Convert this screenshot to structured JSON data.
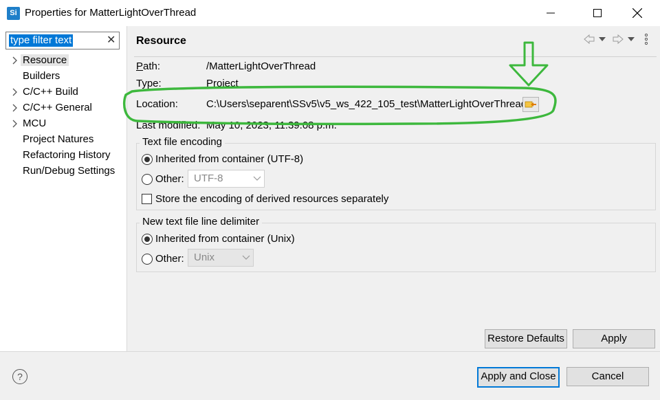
{
  "window": {
    "title": "Properties for MatterLightOverThread",
    "app_icon": "Si",
    "controls": [
      "minimize-icon",
      "maximize-icon",
      "close-icon"
    ]
  },
  "filter": {
    "placeholder": "type filter text",
    "value": "type filter text"
  },
  "tree": {
    "items": [
      {
        "label": "Resource",
        "expandable": true,
        "selected": true
      },
      {
        "label": "Builders",
        "expandable": false
      },
      {
        "label": "C/C++ Build",
        "expandable": true
      },
      {
        "label": "C/C++ General",
        "expandable": true
      },
      {
        "label": "MCU",
        "expandable": true
      },
      {
        "label": "Project Natures",
        "expandable": false
      },
      {
        "label": "Refactoring History",
        "expandable": false
      },
      {
        "label": "Run/Debug Settings",
        "expandable": false
      }
    ]
  },
  "resource": {
    "title": "Resource",
    "path_label": "Path:",
    "path_value": "/MatterLightOverThread",
    "type_label": "Type:",
    "type_value": "Project",
    "location_label": "Location:",
    "location_value": "C:\\Users\\separent\\SSv5\\v5_ws_422_105_test\\MatterLightOverThread",
    "modified_label": "Last modified:",
    "modified_value": "May 10, 2023, 11:39:08 p.m."
  },
  "encoding": {
    "legend": "Text file encoding",
    "inherited_label": "Inherited from container (UTF-8)",
    "other_label": "Other:",
    "other_value": "UTF-8",
    "store_label": "Store the encoding of derived resources separately"
  },
  "delimiter": {
    "legend": "New text file line delimiter",
    "inherited_label": "Inherited from container (Unix)",
    "other_label": "Other:",
    "other_value": "Unix"
  },
  "buttons": {
    "restore": "Restore Defaults",
    "apply": "Apply",
    "apply_close": "Apply and Close",
    "cancel": "Cancel",
    "help": "?"
  },
  "colors": {
    "accent": "#0078d7",
    "annotation": "#3db83d"
  }
}
